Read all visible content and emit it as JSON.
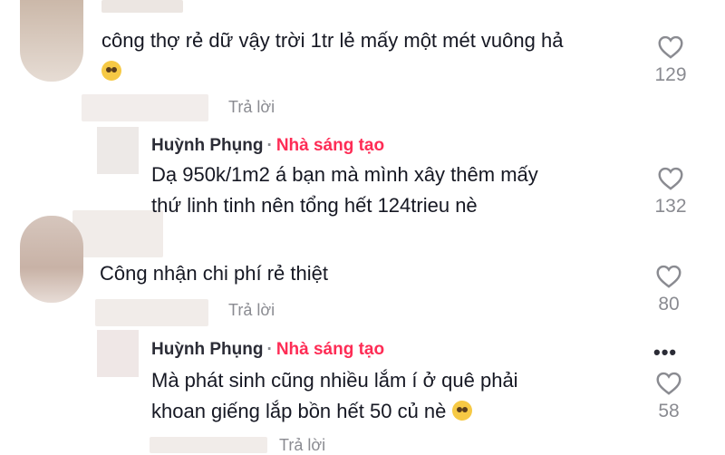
{
  "comments": [
    {
      "text_line1": "công thợ rẻ dữ vậy trời 1tr lẻ mấy một mét vuông hả",
      "text_line2_emoji": "flushed-face",
      "likes": "129",
      "reply_label": "Trả lời"
    },
    {
      "author": "Huỳnh Phụng",
      "separator": "·",
      "badge": "Nhà sáng tạo",
      "text_line1": "Dạ 950k/1m2 á bạn mà mình xây thêm mấy",
      "text_line2": "thứ linh tinh nên tổng hết 124trieu nè",
      "likes": "132"
    },
    {
      "text_line1": "Công nhận chi phí rẻ thiệt",
      "likes": "80",
      "reply_label": "Trả lời"
    },
    {
      "author": "Huỳnh Phụng",
      "separator": "·",
      "badge": "Nhà sáng tạo",
      "text_line1": "Mà phát sinh cũng nhiều lắm í ở quê phải",
      "text_line2": "khoan giếng lắp bồn hết 50 củ nè",
      "text_line2_emoji": "pleading-face",
      "likes": "58",
      "more": "•••",
      "reply_label": "Trả lời"
    }
  ],
  "colors": {
    "creator": "#fe2c55",
    "muted": "#8a8b91",
    "text": "#161823"
  }
}
